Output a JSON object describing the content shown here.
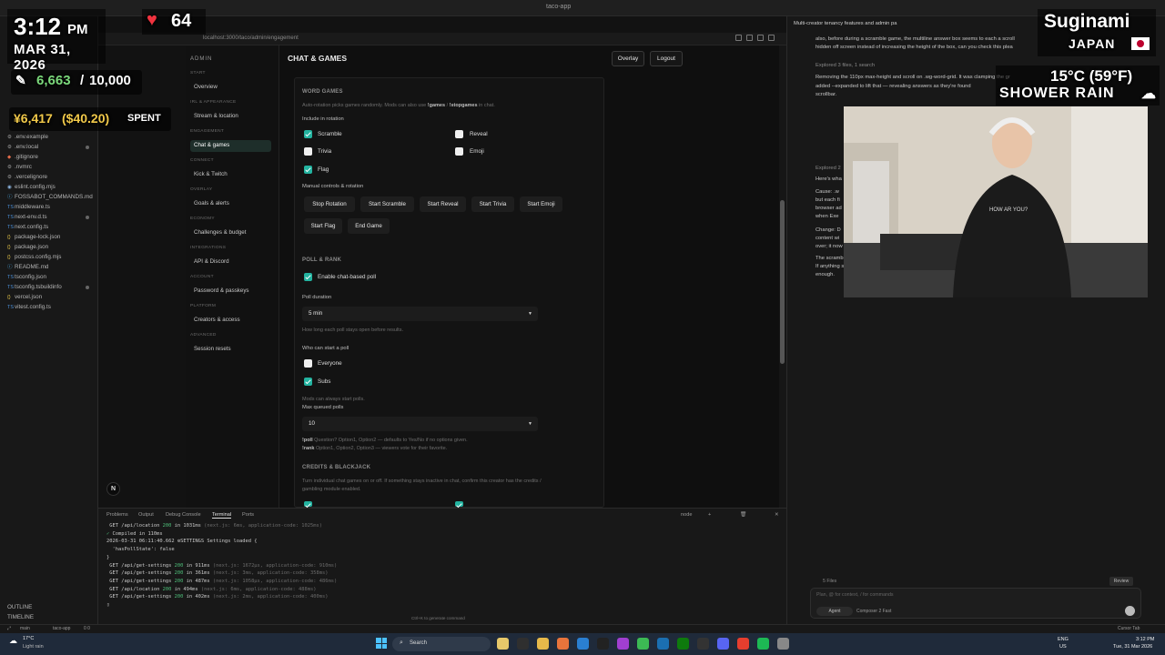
{
  "window": {
    "title": "taco-app"
  },
  "overlay": {
    "time": "3:12",
    "ampm": "PM",
    "date": "MAR 31, 2026",
    "hearts": "64",
    "xp_current": "6,663",
    "xp_sep": "/",
    "xp_total": "10,000",
    "spent_yen": "¥6,417",
    "spent_usd": "($40.20)",
    "spent_label": "SPENT",
    "city": "Suginami",
    "country": "JAPAN",
    "temp": "15°C (59°F)",
    "weather": "SHOWER RAIN"
  },
  "explorer": {
    "files": [
      {
        "name": ".env.example",
        "type": "gy"
      },
      {
        "name": ".env.local",
        "type": "gy",
        "dot": true
      },
      {
        "name": ".gitignore",
        "type": "gr"
      },
      {
        "name": ".nvmrc",
        "type": "gy"
      },
      {
        "name": ".vercelignore",
        "type": "gy"
      },
      {
        "name": "eslint.config.mjs",
        "type": "st"
      },
      {
        "name": "FOSSABOT_COMMANDS.md",
        "type": "md"
      },
      {
        "name": "middleware.ts",
        "type": "ts"
      },
      {
        "name": "next-env.d.ts",
        "type": "ts",
        "dot": true
      },
      {
        "name": "next.config.ts",
        "type": "ts"
      },
      {
        "name": "package-lock.json",
        "type": "js"
      },
      {
        "name": "package.json",
        "type": "js"
      },
      {
        "name": "postcss.config.mjs",
        "type": "js"
      },
      {
        "name": "README.md",
        "type": "md"
      },
      {
        "name": "tsconfig.json",
        "type": "ts"
      },
      {
        "name": "tsconfig.tsbuildinfo",
        "type": "ts",
        "dot": true
      },
      {
        "name": "vercel.json",
        "type": "js"
      },
      {
        "name": "vitest.config.ts",
        "type": "ts"
      }
    ],
    "outline": "OUTLINE",
    "timeline": "TIMELINE"
  },
  "browser": {
    "url": "localhost:3000/taco/admin/engagement"
  },
  "admin": {
    "title": "ADMIN",
    "nav": [
      {
        "header": "START",
        "item": "Overview"
      },
      {
        "header": "IRL & APPEARANCE",
        "item": "Stream & location"
      },
      {
        "header": "ENGAGEMENT",
        "item": "Chat & games",
        "active": true
      },
      {
        "header": "CONNECT",
        "item": "Kick & Twitch"
      },
      {
        "header": "OVERLAY",
        "item": "Goals & alerts"
      },
      {
        "header": "ECONOMY",
        "item": "Challenges & budget"
      },
      {
        "header": "INTEGRATIONS",
        "item": "API & Discord"
      },
      {
        "header": "ACCOUNT",
        "item": "Password & passkeys"
      },
      {
        "header": "PLATFORM",
        "item": "Creators & access"
      },
      {
        "header": "ADVANCED",
        "item": "Session resets"
      }
    ],
    "page_title": "CHAT & GAMES",
    "overlay_btn": "Overlay",
    "logout_btn": "Logout",
    "word_games": {
      "title": "WORD GAMES",
      "help_prefix": "Auto-rotation picks games randomly. Mods can also use ",
      "help_cmd1": "!games",
      "help_mid": " / ",
      "help_cmd2": "!stopgames",
      "help_suffix": " in chat.",
      "include_label": "Include in rotation",
      "options": [
        {
          "label": "Scramble",
          "checked": true
        },
        {
          "label": "Reveal",
          "checked": false
        },
        {
          "label": "Trivia",
          "checked": false
        },
        {
          "label": "Emoji",
          "checked": false
        },
        {
          "label": "Flag",
          "checked": true
        }
      ],
      "manual_label": "Manual controls & rotation",
      "buttons": [
        "Stop Rotation",
        "Start Scramble",
        "Start Reveal",
        "Start Trivia",
        "Start Emoji",
        "Start Flag",
        "End Game"
      ]
    },
    "poll": {
      "title": "POLL & RANK",
      "enable_label": "Enable chat-based poll",
      "duration_label": "Poll duration",
      "duration_value": "5 min",
      "duration_help": "How long each poll stays open before results.",
      "who_label": "Who can start a poll",
      "everyone": "Everyone",
      "subs": "Subs",
      "mods_help": "Mods can always start polls.",
      "max_label": "Max queued polls",
      "max_value": "10",
      "help1_cmd": "!poll",
      "help1": " Question? Option1, Option2 — defaults to Yes/No if no options given.",
      "help2_cmd": "!rank",
      "help2": " Option1, Option2, Option3 — viewers vote for their favorite."
    },
    "credits": {
      "title": "CREDITS & BLACKJACK",
      "help1": "Turn individual chat games on or off. If something stays inactive in chat, confirm this creator has the credits /",
      "help2": "gambling module enabled."
    }
  },
  "terminal": {
    "tabs": [
      "Problems",
      "Output",
      "Debug Console",
      "Terminal",
      "Ports"
    ],
    "active_tab": "Terminal",
    "shell": "node",
    "lines": [
      {
        "a": " GET /api/location ",
        "b": "200",
        "c": " in 1031ms ",
        "d": "(next.js: 6ms, application-code: 1025ms)"
      },
      {
        "a": "",
        "b": "✓",
        "c": " Compiled in 110ms",
        "d": ""
      },
      {
        "a": "2026-03-31 06:11:40.662 ",
        "b": "",
        "c": "⚙SETTINGS Settings loaded {",
        "d": ""
      },
      {
        "a": "  'hasPollState': false",
        "b": "",
        "c": "",
        "d": ""
      },
      {
        "a": "}",
        "b": "",
        "c": "",
        "d": ""
      },
      {
        "a": " GET /api/get-settings ",
        "b": "200",
        "c": " in 911ms ",
        "d": "(next.js: 1672µs, application-code: 910ms)"
      },
      {
        "a": " GET /api/get-settings ",
        "b": "200",
        "c": " in 361ms ",
        "d": "(next.js: 3ms, application-code: 358ms)"
      },
      {
        "a": " GET /api/get-settings ",
        "b": "200",
        "c": " in 487ms ",
        "d": "(next.js: 1058µs, application-code: 486ms)"
      },
      {
        "a": " GET /api/location ",
        "b": "200",
        "c": " in 494ms ",
        "d": "(next.js: 6ms, application-code: 488ms)"
      },
      {
        "a": " GET /api/get-settings ",
        "b": "200",
        "c": " in 402ms ",
        "d": "(next.js: 2ms, application-code: 400ms)"
      },
      {
        "a": "▯",
        "b": "",
        "c": "",
        "d": ""
      }
    ],
    "hint": "Ctrl+K to generate command"
  },
  "chat": {
    "title": "Multi-creator tenancy features and admin pa",
    "lines": [
      "also, before during a scramble game, the multiline answer box seems to each a scroll",
      "hidden off screen instead of increasing the height of the box, can you check this plea",
      "Explored 3 files, 1 search",
      "Removing the 110px max-height and scroll on .wg-word-grid. It was clamping the gr",
      "added --expanded to lift that — revealing answers as they're found",
      "scrollbar.",
      "Explored 2",
      "Here's wha",
      "Cause: .w",
      "but each fi",
      "browser ad",
      "when Exe",
      "Change: D",
      "content wi",
      "over; it now",
      "The scramb",
      "If anything still clips, it would be a parent with a fixed height—but the panel is normally content-sized, so this should be",
      "enough."
    ],
    "files_changed": "5 Files",
    "review": "Review",
    "placeholder": "Plan, @ for context, / for commands",
    "agent": "Agent",
    "model": "Composer 2 Fast"
  },
  "statusbar": {
    "branch": "main",
    "project": "taco-app",
    "errors": "0 0",
    "right": "Cursor Tab"
  },
  "taskbar": {
    "weather_temp": "17°C",
    "weather_desc": "Light rain",
    "search": "Search",
    "lang1": "ENG",
    "lang2": "US",
    "clock": "3:12 PM",
    "date": "Tue, 31 Mar 2026"
  }
}
